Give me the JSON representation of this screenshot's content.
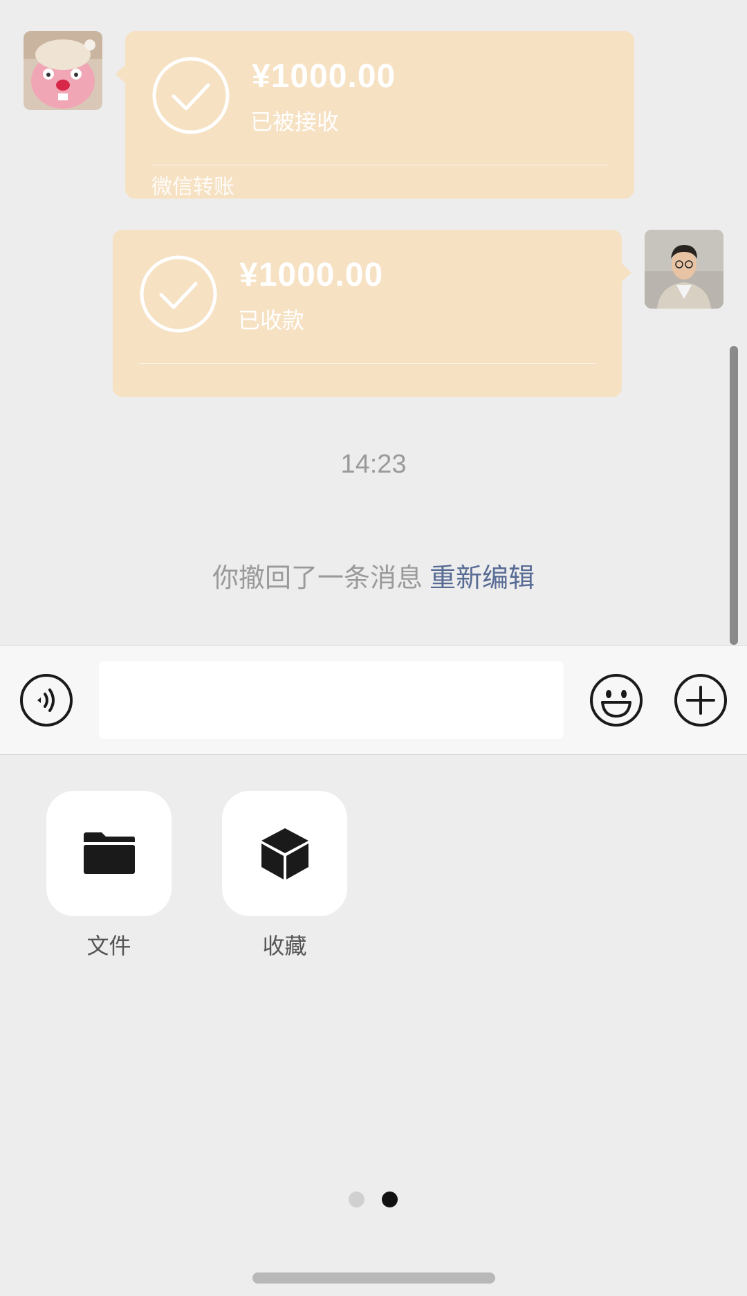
{
  "messages": [
    {
      "side": "left",
      "amount": "¥1000.00",
      "status": "已被接收",
      "footer": "微信转账",
      "avatar_icon": "pink-plush-toy-avatar"
    },
    {
      "side": "right",
      "amount": "¥1000.00",
      "status": "已收款",
      "footer": "",
      "avatar_icon": "man-in-suit-avatar"
    }
  ],
  "timestamp": "14:23",
  "recall_notice": {
    "text": "你撤回了一条消息",
    "action": "重新编辑"
  },
  "input_bar": {
    "voice_icon": "voice-icon",
    "emoji_icon": "emoji-icon",
    "plus_icon": "plus-icon",
    "text_value": ""
  },
  "panel": {
    "items": [
      {
        "label": "文件",
        "icon": "folder-icon"
      },
      {
        "label": "收藏",
        "icon": "cube-icon"
      }
    ],
    "page_count": 2,
    "current_page": 2
  },
  "colors": {
    "bubble": "#f6e1c3",
    "link": "#576b95",
    "background": "#ededed"
  }
}
